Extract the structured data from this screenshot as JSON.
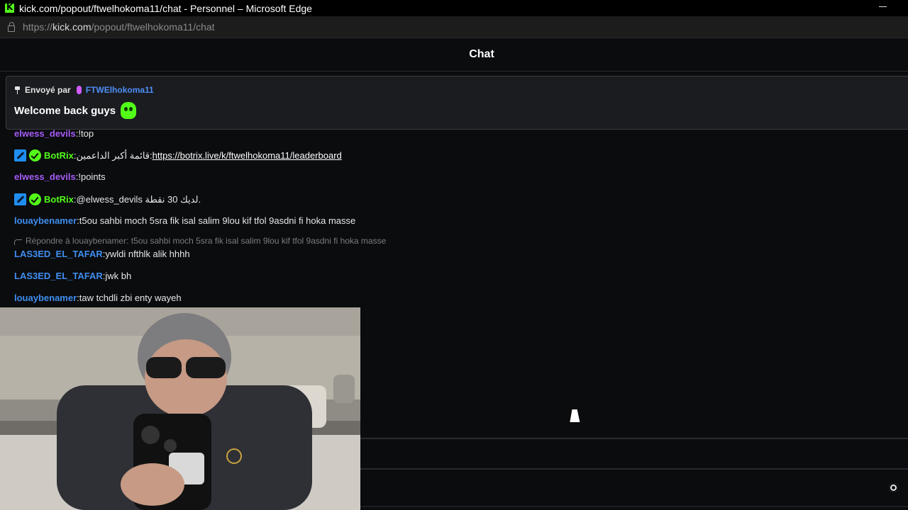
{
  "window": {
    "title": "kick.com/popout/ftwelhokoma11/chat - Personnel – Microsoft Edge",
    "url_scheme": "https://",
    "url_host": "kick.com",
    "url_path": "/popout/ftwelhokoma11/chat"
  },
  "chat": {
    "title": "Chat"
  },
  "pinned": {
    "sent_by_label": "Envoyé par",
    "user": "FTWElhokoma11",
    "message": "Welcome back guys"
  },
  "messages": [
    {
      "user": "elwess_devils",
      "color": "purple",
      "text": "!top"
    },
    {
      "user": "BotRix",
      "color": "green",
      "text": "قائمة أكبر الداعمين: ",
      "link": "https://botrix.live/k/ftwelhokoma11/leaderboard"
    },
    {
      "user": "elwess_devils",
      "color": "purple",
      "text": "!points"
    },
    {
      "user": "BotRix",
      "color": "green",
      "text": "@elwess_devils لديك 30 نقطة."
    },
    {
      "user": "louaybenamer",
      "color": "blue",
      "text": "t5ou sahbi moch 5sra fik isal salim 9lou kif tfol 9asdni fi hoka masse"
    },
    {
      "user": "LAS3ED_EL_TAFAR",
      "color": "blue",
      "text": "ywldi nfthlk alik hhhh"
    },
    {
      "user": "LAS3ED_EL_TAFAR",
      "color": "blue",
      "text": "jwk bh"
    },
    {
      "user": "louaybenamer",
      "color": "blue",
      "text": "taw tchdli zbi enty wayeh"
    }
  ],
  "reply": {
    "text": "Répondre à louaybenamer: t5ou sahbi moch 5sra fik isal salim 9lou kif tfol 9asdni fi hoka masse"
  },
  "colors": {
    "accent": "#53fc18",
    "background": "#0b0c0e",
    "purple_user": "#a55cf7",
    "blue_user": "#3f8ef0"
  }
}
